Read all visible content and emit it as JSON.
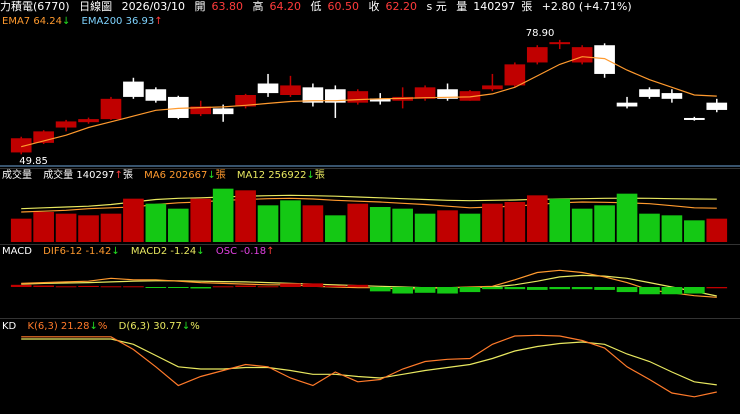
{
  "header": {
    "stock": "力積電(6770)",
    "period": "日線圖",
    "date": "2026/03/10",
    "open_label": "開",
    "open": "63.80",
    "high_label": "高",
    "high": "64.20",
    "low_label": "低",
    "low": "60.50",
    "close_label": "收",
    "close": "62.20",
    "unit": "s 元",
    "vol_label": "量",
    "vol": "140297",
    "vol_unit": "張",
    "change": "+2.80 (+4.71%)"
  },
  "price_panel": {
    "ema7": "EMA7 64.24",
    "ema7_arrow": "↓",
    "ema200": "EMA200 36.93",
    "ema200_arrow": "↑",
    "max_label": "78.90",
    "min_label": "49.85"
  },
  "volume_panel": {
    "title": "成交量",
    "vol": "成交量 140297",
    "vol_arrow": "↑",
    "vol_unit": "張",
    "ma6": "MA6 202667",
    "ma6_arrow": "↓",
    "ma6_unit": "張",
    "ma12": "MA12 256922",
    "ma12_arrow": "↓",
    "ma12_unit": "張"
  },
  "macd_panel": {
    "title": "MACD",
    "dif": "DIF6-12 -1.42",
    "dif_arrow": "↓",
    "macd2": "MACD2 -1.24",
    "macd2_arrow": "↓",
    "osc": "OSC -0.18",
    "osc_arrow": "↑"
  },
  "kd_panel": {
    "title": "KD",
    "k": "K(6,3) 21.28",
    "k_arrow": "↓",
    "k_unit": "%",
    "d": "D(6,3) 30.77",
    "d_arrow": "↓",
    "d_unit": "%"
  },
  "colors": {
    "up": "#c00000",
    "down": "#ffffff",
    "vol_up": "#c00000",
    "vol_down": "#14c814",
    "ema7": "#ff9a2e",
    "ema200": "#7fd4ff",
    "ma6": "#ff9a2e",
    "ma12": "#e8e860",
    "dif": "#ff9a2e",
    "macd2": "#e8e860",
    "osc_up": "#c00000",
    "osc_down": "#14c814",
    "k": "#ff7a2a",
    "d": "#e8e860"
  },
  "chart_data": [
    {
      "type": "candlestick",
      "name": "price",
      "y_range": [
        47,
        82
      ],
      "candles": [
        {
          "o": 49.5,
          "c": 53.2,
          "h": 53.6,
          "l": 49.0
        },
        {
          "o": 52.0,
          "c": 55.0,
          "h": 55.3,
          "l": 51.7
        },
        {
          "o": 56.0,
          "c": 57.6,
          "h": 58.0,
          "l": 55.0
        },
        {
          "o": 57.4,
          "c": 58.2,
          "h": 58.6,
          "l": 57.0
        },
        {
          "o": 58.2,
          "c": 63.5,
          "h": 64.0,
          "l": 58.0
        },
        {
          "o": 68.0,
          "c": 64.0,
          "h": 69.0,
          "l": 63.5
        },
        {
          "o": 66.0,
          "c": 63.0,
          "h": 66.5,
          "l": 62.5
        },
        {
          "o": 64.0,
          "c": 58.5,
          "h": 64.3,
          "l": 58.2
        },
        {
          "o": 59.5,
          "c": 61.5,
          "h": 63.0,
          "l": 59.0
        },
        {
          "o": 61.0,
          "c": 59.5,
          "h": 62.0,
          "l": 57.5
        },
        {
          "o": 61.5,
          "c": 64.5,
          "h": 64.8,
          "l": 61.0
        },
        {
          "o": 67.5,
          "c": 65.0,
          "h": 70.0,
          "l": 64.0
        },
        {
          "o": 64.5,
          "c": 67.0,
          "h": 69.5,
          "l": 64.0
        },
        {
          "o": 66.5,
          "c": 62.5,
          "h": 67.5,
          "l": 61.5
        },
        {
          "o": 66.0,
          "c": 62.5,
          "h": 67.0,
          "l": 58.5
        },
        {
          "o": 62.5,
          "c": 65.5,
          "h": 66.0,
          "l": 62.0
        },
        {
          "o": 63.6,
          "c": 62.8,
          "h": 65.0,
          "l": 62.0
        },
        {
          "o": 63.0,
          "c": 64.0,
          "h": 66.5,
          "l": 61.0
        },
        {
          "o": 63.5,
          "c": 66.5,
          "h": 67.0,
          "l": 63.0
        },
        {
          "o": 66.0,
          "c": 63.5,
          "h": 67.5,
          "l": 63.0
        },
        {
          "o": 63.0,
          "c": 65.5,
          "h": 65.8,
          "l": 63.0
        },
        {
          "o": 66.0,
          "c": 67.0,
          "h": 70.0,
          "l": 65.5
        },
        {
          "o": 67.0,
          "c": 72.5,
          "h": 73.0,
          "l": 66.5
        },
        {
          "o": 73.0,
          "c": 77.0,
          "h": 77.5,
          "l": 72.5
        },
        {
          "o": 78.3,
          "c": 78.3,
          "h": 78.9,
          "l": 76.5
        },
        {
          "o": 73.0,
          "c": 77.0,
          "h": 77.5,
          "l": 72.5
        },
        {
          "o": 77.5,
          "c": 70.0,
          "h": 78.0,
          "l": 69.0
        },
        {
          "o": 62.5,
          "c": 61.5,
          "h": 64.0,
          "l": 61.0
        },
        {
          "o": 66.0,
          "c": 64.0,
          "h": 66.5,
          "l": 63.5
        },
        {
          "o": 65.0,
          "c": 63.5,
          "h": 66.0,
          "l": 62.5
        },
        {
          "o": 58.5,
          "c": 58.0,
          "h": 58.8,
          "l": 57.8
        },
        {
          "o": 62.5,
          "c": 60.6,
          "h": 63.5,
          "l": 60.0
        }
      ],
      "ema7": [
        51.0,
        52.5,
        54.0,
        56.0,
        57.5,
        59.0,
        60.5,
        61.0,
        61.2,
        61.4,
        61.8,
        62.3,
        62.8,
        63.0,
        63.0,
        63.3,
        63.5,
        63.6,
        63.8,
        63.9,
        64.0,
        64.8,
        66.5,
        69.5,
        72.5,
        74.5,
        74.0,
        71.0,
        68.5,
        66.5,
        64.5,
        64.2
      ],
      "min_price": 49.85,
      "max_price": 78.9
    },
    {
      "type": "bar",
      "name": "volume",
      "y_range": [
        0,
        360000
      ],
      "values": [
        140000,
        180000,
        170000,
        160000,
        170000,
        260000,
        230000,
        200000,
        260000,
        320000,
        310000,
        220000,
        250000,
        220000,
        160000,
        230000,
        210000,
        200000,
        170000,
        190000,
        170000,
        230000,
        240000,
        280000,
        260000,
        200000,
        220000,
        290000,
        170000,
        160000,
        130000,
        140000
      ],
      "up": [
        1,
        1,
        1,
        1,
        1,
        1,
        0,
        0,
        1,
        0,
        1,
        0,
        0,
        1,
        0,
        1,
        0,
        0,
        0,
        1,
        0,
        1,
        1,
        1,
        0,
        0,
        0,
        0,
        0,
        0,
        0,
        1
      ],
      "ma6": [
        180000,
        185000,
        190000,
        200000,
        205000,
        210000,
        225000,
        235000,
        240000,
        250000,
        255000,
        260000,
        262000,
        258000,
        250000,
        245000,
        240000,
        232000,
        225000,
        215000,
        205000,
        210000,
        215000,
        225000,
        235000,
        240000,
        238000,
        235000,
        230000,
        218000,
        205000,
        202667
      ],
      "ma12": [
        200000,
        205000,
        210000,
        215000,
        225000,
        240000,
        255000,
        262000,
        265000,
        270000,
        275000,
        278000,
        280000,
        278000,
        275000,
        270000,
        265000,
        260000,
        255000,
        250000,
        248000,
        250000,
        252000,
        256000,
        258000,
        260000,
        262000,
        263000,
        262000,
        260000,
        258000,
        256922
      ]
    },
    {
      "type": "bar",
      "name": "macd",
      "y_range": [
        -4,
        4
      ],
      "osc": [
        0.3,
        0.2,
        0.1,
        0.15,
        0.1,
        0.1,
        -0.1,
        0,
        -0.2,
        0.1,
        0.2,
        0.1,
        0.5,
        0.5,
        0.2,
        0.3,
        -0.6,
        -0.9,
        -0.8,
        -0.9,
        -0.7,
        -0.3,
        -0.3,
        -0.4,
        -0.3,
        -0.3,
        -0.4,
        -0.7,
        -1.0,
        -1.0,
        -0.9,
        -0.18
      ],
      "osc_sign": [
        1,
        1,
        1,
        1,
        1,
        1,
        0,
        0,
        0,
        1,
        1,
        1,
        1,
        1,
        1,
        1,
        0,
        0,
        0,
        0,
        0,
        0,
        0,
        0,
        0,
        0,
        0,
        0,
        0,
        0,
        0,
        1
      ],
      "dif": [
        0.5,
        0.6,
        0.7,
        0.8,
        1.2,
        1.0,
        1.0,
        0.8,
        0.6,
        0.5,
        0.4,
        0.3,
        0.3,
        0.1,
        0,
        -0.1,
        -0.1,
        -0.3,
        -0.2,
        -0.1,
        0,
        0.1,
        1.0,
        2.0,
        2.3,
        2.0,
        1.4,
        0.6,
        -0.4,
        -0.8,
        -1.2,
        -1.42
      ],
      "macd2": [
        0.4,
        0.5,
        0.55,
        0.6,
        0.7,
        0.8,
        0.85,
        0.85,
        0.8,
        0.75,
        0.7,
        0.6,
        0.5,
        0.4,
        0.3,
        0.2,
        0.1,
        0,
        -0.1,
        -0.1,
        -0.05,
        0,
        0.3,
        0.8,
        1.4,
        1.6,
        1.5,
        1.2,
        0.6,
        0,
        -0.6,
        -1.24
      ]
    },
    {
      "type": "line",
      "name": "kd",
      "y_range": [
        0,
        100
      ],
      "k": [
        95,
        95,
        95,
        95,
        95,
        78,
        55,
        30,
        42,
        50,
        58,
        55,
        40,
        30,
        48,
        35,
        38,
        52,
        62,
        65,
        66,
        85,
        96,
        97,
        96,
        90,
        80,
        55,
        38,
        20,
        15,
        21.28
      ],
      "d": [
        92,
        92,
        92,
        92,
        92,
        85,
        70,
        55,
        52,
        52,
        54,
        54,
        50,
        45,
        45,
        42,
        40,
        45,
        50,
        54,
        58,
        66,
        76,
        82,
        86,
        88,
        85,
        72,
        62,
        48,
        35,
        30.77
      ]
    }
  ]
}
